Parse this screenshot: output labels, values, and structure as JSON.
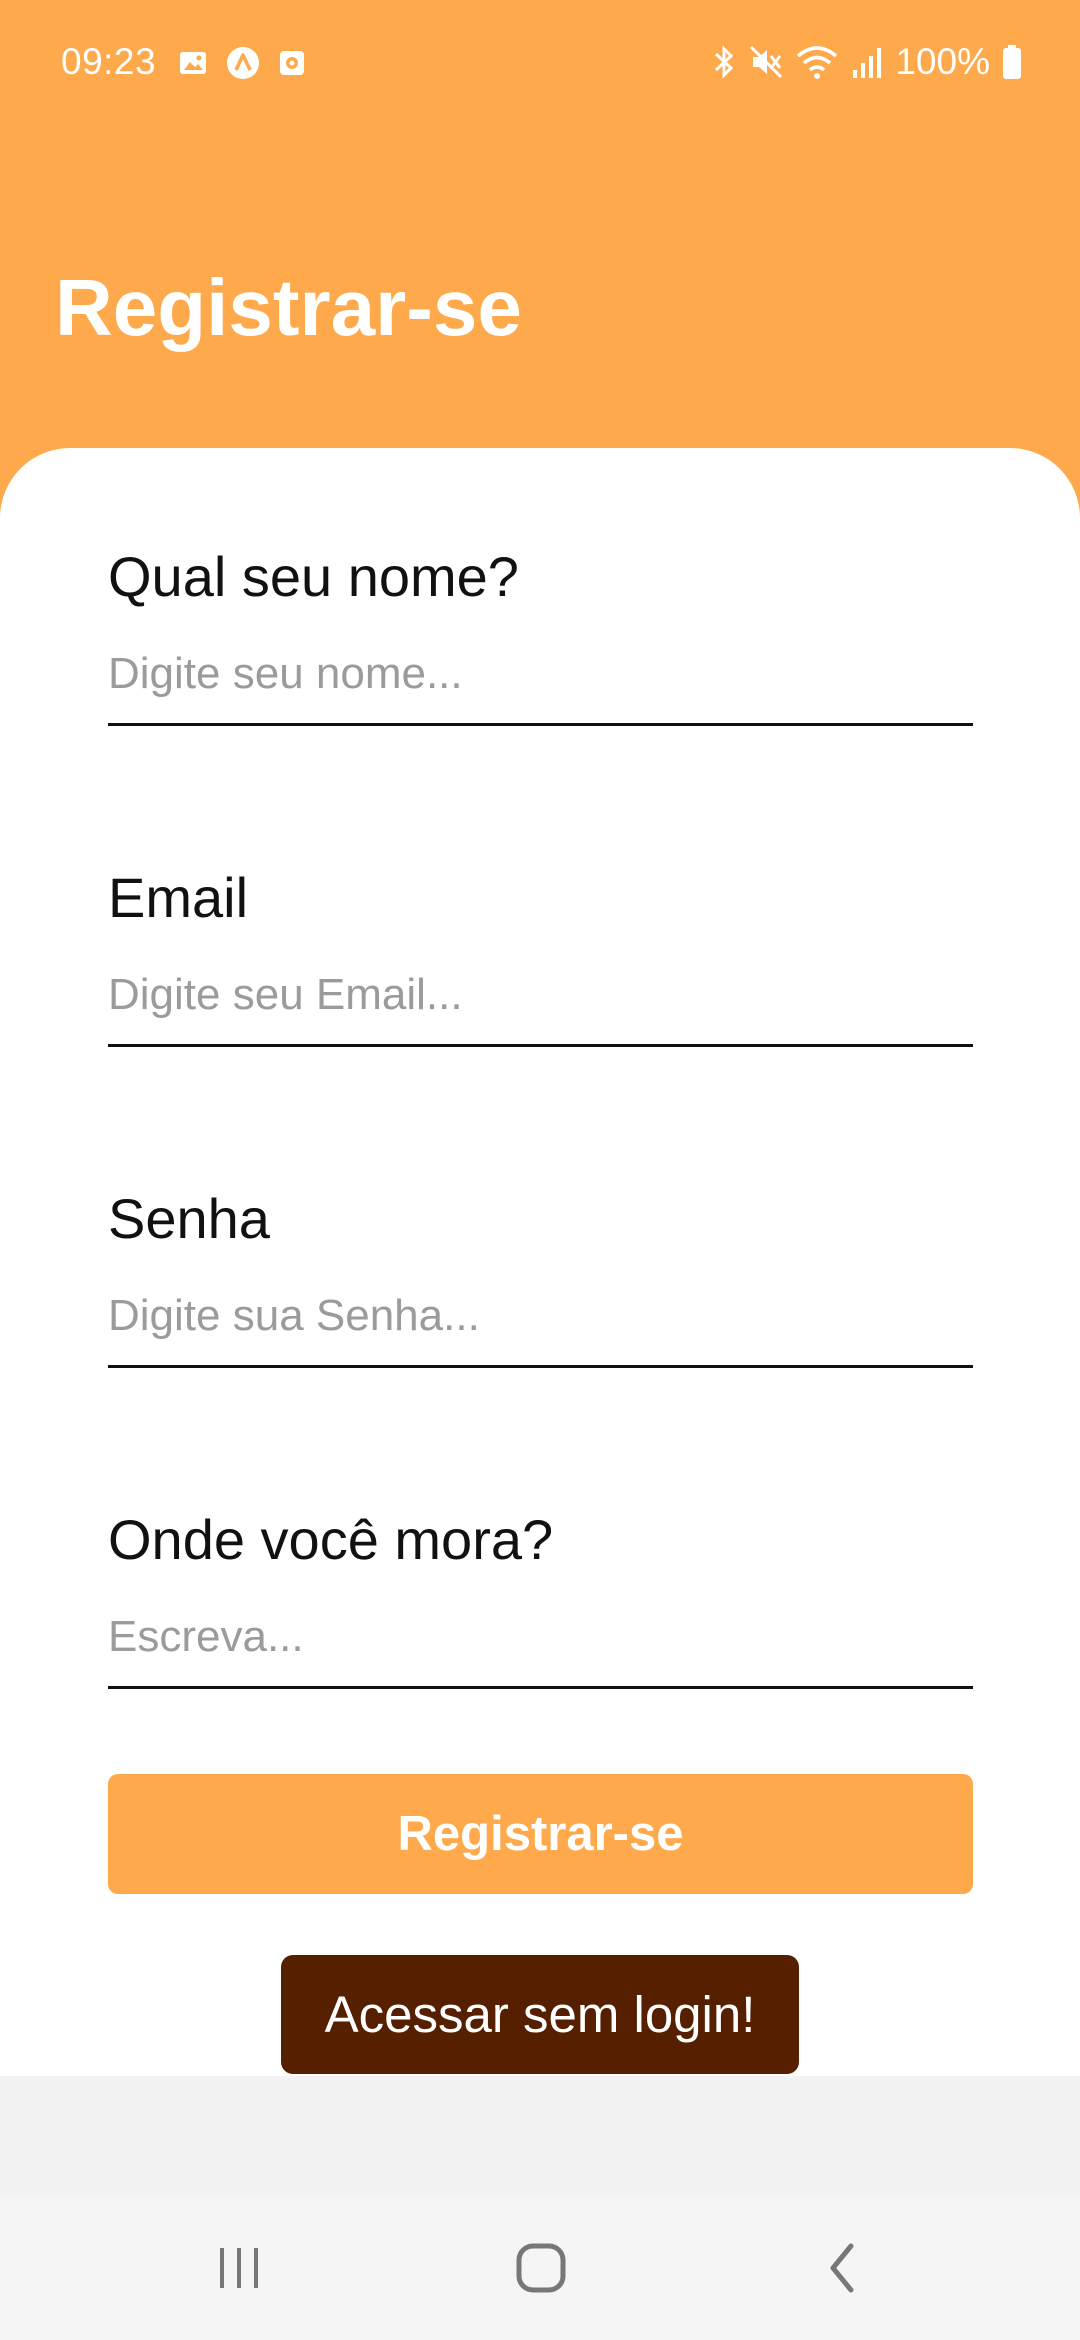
{
  "status_bar": {
    "time": "09:23",
    "battery": "100%",
    "notification_icons": [
      "gallery-icon",
      "app-a-icon",
      "media-icon"
    ],
    "system_icons": [
      "bluetooth-icon",
      "mute-icon",
      "wifi-icon",
      "signal-icon",
      "battery-icon"
    ]
  },
  "header": {
    "title": "Registrar-se"
  },
  "form": {
    "name": {
      "label": "Qual seu nome?",
      "placeholder": "Digite seu nome...",
      "value": ""
    },
    "email": {
      "label": "Email",
      "placeholder": "Digite seu Email...",
      "value": ""
    },
    "password": {
      "label": "Senha",
      "placeholder": "Digite sua Senha...",
      "value": ""
    },
    "address": {
      "label": "Onde você mora?",
      "placeholder": "Escreva...",
      "value": ""
    }
  },
  "buttons": {
    "register": "Registrar-se",
    "guest": "Acessar sem login!"
  },
  "colors": {
    "accent": "#fea94b",
    "guest_button": "#561f00",
    "text": "#111111",
    "placeholder": "#9b9b9b"
  },
  "nav_bar": {
    "buttons": [
      "recent-apps-icon",
      "home-icon",
      "back-icon"
    ]
  }
}
